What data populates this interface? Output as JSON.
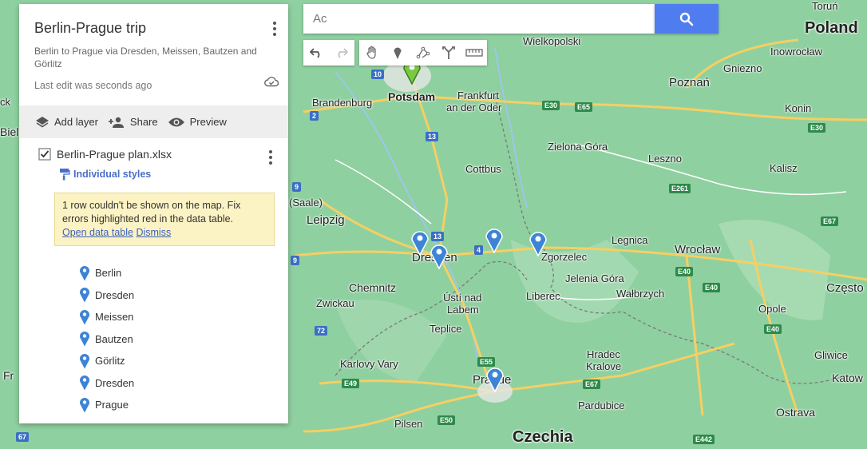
{
  "search": {
    "placeholder": "Ac",
    "value": ""
  },
  "panel": {
    "title": "Berlin-Prague trip",
    "description": "Berlin to Prague via Dresden, Meissen, Bautzen and Görlitz",
    "last_edit": "Last edit was seconds ago",
    "actions": {
      "add_layer": "Add layer",
      "share": "Share",
      "preview": "Preview"
    },
    "layer": {
      "name": "Berlin-Prague plan.xlsx",
      "checked": true,
      "styles_label": "Individual styles",
      "warning_text": "1 row couldn't be shown on the map. Fix errors highlighted red in the data table.",
      "warning_link1": "Open data table",
      "warning_link2": "Dismiss",
      "places": [
        {
          "name": "Berlin"
        },
        {
          "name": "Dresden"
        },
        {
          "name": "Meissen"
        },
        {
          "name": "Bautzen"
        },
        {
          "name": "Görlitz"
        },
        {
          "name": "Dresden"
        },
        {
          "name": "Prague"
        }
      ]
    }
  },
  "map": {
    "labels": [
      {
        "text": "Poland",
        "size": "big"
      },
      {
        "text": "Czechia",
        "size": "big"
      },
      {
        "text": "Wielkopolski",
        "size": "small"
      },
      {
        "text": "Inowrocław",
        "size": "small"
      },
      {
        "text": "Gniezno",
        "size": "small"
      },
      {
        "text": "Poznań",
        "size": "city"
      },
      {
        "text": "Konin",
        "size": "small"
      },
      {
        "text": "Potsdam",
        "size": "town"
      },
      {
        "text": "Brandenburg",
        "size": "small"
      },
      {
        "text": "Frankfurt",
        "size": "small"
      },
      {
        "text": "an der Oder",
        "size": "small"
      },
      {
        "text": "Zielona Góra",
        "size": "small"
      },
      {
        "text": "Leszno",
        "size": "small"
      },
      {
        "text": "Kalisz",
        "size": "small"
      },
      {
        "text": "Cottbus",
        "size": "small"
      },
      {
        "text": "(Saale)",
        "size": "small"
      },
      {
        "text": "Leipzig",
        "size": "city"
      },
      {
        "text": "Dresden",
        "size": "city"
      },
      {
        "text": "Zgorzelec",
        "size": "small"
      },
      {
        "text": "Legnica",
        "size": "small"
      },
      {
        "text": "Wrocław",
        "size": "city"
      },
      {
        "text": "Chemnitz",
        "size": "town"
      },
      {
        "text": "Zwickau",
        "size": "small"
      },
      {
        "text": "Ústí nad",
        "size": "small"
      },
      {
        "text": "Labem",
        "size": "small"
      },
      {
        "text": "Teplice",
        "size": "small"
      },
      {
        "text": "Liberec",
        "size": "small"
      },
      {
        "text": "Jelenia Góra",
        "size": "small"
      },
      {
        "text": "Wałbrzych",
        "size": "small"
      },
      {
        "text": "Opole",
        "size": "small"
      },
      {
        "text": "Często",
        "size": "city"
      },
      {
        "text": "Hradec",
        "size": "small"
      },
      {
        "text": "Kralove",
        "size": "small"
      },
      {
        "text": "Karlovy Vary",
        "size": "small"
      },
      {
        "text": "Prague",
        "size": "city"
      },
      {
        "text": "Pardubice",
        "size": "small"
      },
      {
        "text": "Pilsen",
        "size": "small"
      },
      {
        "text": "Gliwice",
        "size": "small"
      },
      {
        "text": "Katow",
        "size": "town"
      },
      {
        "text": "Ostrava",
        "size": "town"
      },
      {
        "text": "Toruń",
        "size": "small"
      },
      {
        "text": "Fr",
        "size": "town"
      },
      {
        "text": "Biel",
        "size": "town"
      },
      {
        "text": "ck",
        "size": "small"
      }
    ],
    "shields": [
      {
        "text": "10",
        "color": "blue"
      },
      {
        "text": "2",
        "color": "blue"
      },
      {
        "text": "13",
        "color": "blue"
      },
      {
        "text": "E30",
        "color": "green"
      },
      {
        "text": "E65",
        "color": "green"
      },
      {
        "text": "E30",
        "color": "green"
      },
      {
        "text": "E261",
        "color": "green"
      },
      {
        "text": "E67",
        "color": "green"
      },
      {
        "text": "13",
        "color": "blue"
      },
      {
        "text": "4",
        "color": "blue"
      },
      {
        "text": "9",
        "color": "blue"
      },
      {
        "text": "9",
        "color": "blue"
      },
      {
        "text": "E40",
        "color": "green"
      },
      {
        "text": "E40",
        "color": "green"
      },
      {
        "text": "E40",
        "color": "green"
      },
      {
        "text": "72",
        "color": "blue"
      },
      {
        "text": "E55",
        "color": "green"
      },
      {
        "text": "E49",
        "color": "green"
      },
      {
        "text": "E67",
        "color": "green"
      },
      {
        "text": "E50",
        "color": "green"
      },
      {
        "text": "E442",
        "color": "green"
      },
      {
        "text": "67",
        "color": "blue"
      }
    ]
  }
}
